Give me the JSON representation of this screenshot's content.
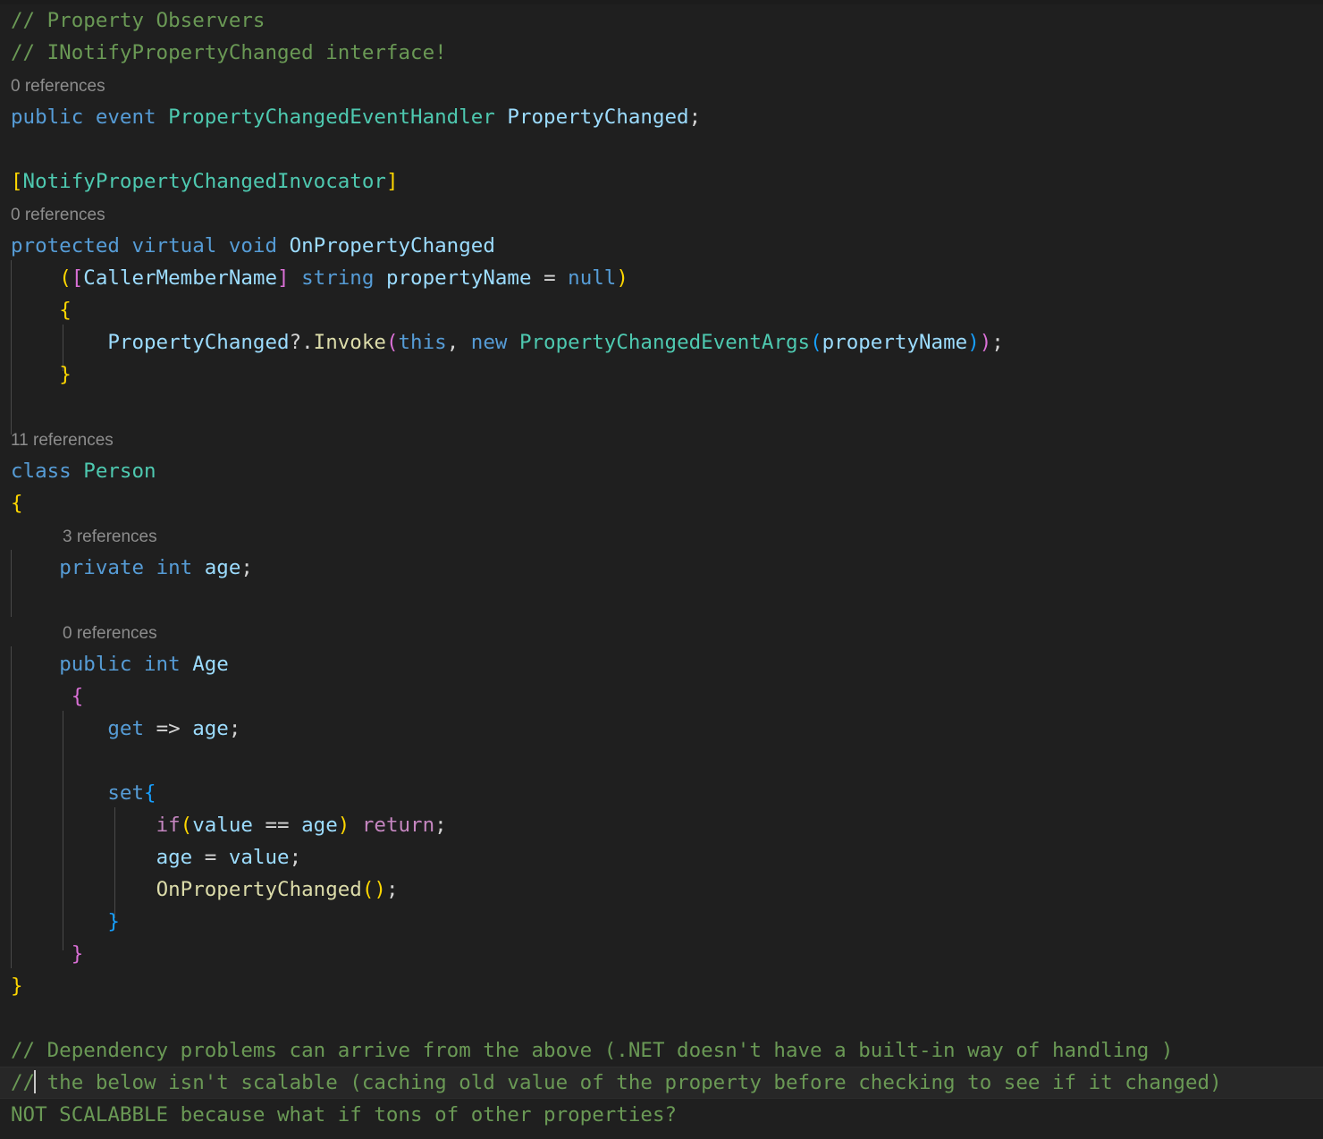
{
  "editor": {
    "language": "csharp",
    "theme": "Dark+",
    "background_color": "#1f1f1f",
    "current_line_background": "#272727",
    "indent_guide_color": "#494949",
    "cursor_color": "#c8c8c8",
    "colors": {
      "comment": "#6a9955",
      "keyword": "#569cd6",
      "control_keyword": "#c586c0",
      "type": "#4ec9b0",
      "identifier": "#9cdcfe",
      "function": "#dcdcaa",
      "plain": "#d4d4d4",
      "codelens": "#8d8d8d",
      "bracket_level_0": "#ffd700",
      "bracket_level_1": "#da70d6",
      "bracket_level_2": "#179fff"
    }
  },
  "codelens": {
    "event_refs": "0 references",
    "onpropertychanged_refs": "0 references",
    "class_person_refs": "11 references",
    "age_field_refs": "3 references",
    "age_property_refs": "0 references"
  },
  "code": {
    "comment_property_observers": "// Property Observers",
    "comment_inotifypropertychanged": "// INotifyPropertyChanged interface!",
    "line_public_event": {
      "public": "public",
      "event": "event",
      "handler_type": "PropertyChangedEventHandler",
      "member": "PropertyChanged",
      "semicolon": ";"
    },
    "attribute_invocator": {
      "open": "[",
      "name": "NotifyPropertyChangedInvocator",
      "close": "]"
    },
    "method_signature": {
      "protected": "protected",
      "virtual": "virtual",
      "void": "void",
      "name": "OnPropertyChanged"
    },
    "method_params": {
      "open_paren": "(",
      "attr_open": "[",
      "attr_name": "CallerMemberName",
      "attr_close": "]",
      "string": "string",
      "param": "propertyName",
      "equals": "=",
      "null": "null",
      "close_paren": ")"
    },
    "method_open_brace": "{",
    "invoke_line": {
      "member": "PropertyChanged",
      "null_conditional": "?.",
      "invoke": "Invoke",
      "open_paren": "(",
      "this": "this",
      "comma": ",",
      "new": "new",
      "args_type": "PropertyChangedEventArgs",
      "args_open_paren": "(",
      "arg": "propertyName",
      "args_close_paren": ")",
      "close_paren": ")",
      "semicolon": ";"
    },
    "method_close_brace": "}",
    "class_decl": {
      "class": "class",
      "name": "Person"
    },
    "class_open_brace": "{",
    "field_age": {
      "private": "private",
      "int": "int",
      "name": "age",
      "semicolon": ";"
    },
    "property_age": {
      "public": "public",
      "int": "int",
      "name": "Age"
    },
    "property_open_brace": "{",
    "getter": {
      "get": "get",
      "arrow": "=>",
      "field": "age",
      "semicolon": ";"
    },
    "setter_open": {
      "set": "set",
      "brace": "{"
    },
    "setter_guard": {
      "if": "if",
      "open_paren": "(",
      "value": "value",
      "operator": "==",
      "field": "age",
      "close_paren": ")",
      "return": "return",
      "semicolon": ";"
    },
    "setter_assign": {
      "field": "age",
      "equals": "=",
      "value": "value",
      "semicolon": ";"
    },
    "setter_notify": {
      "call": "OnPropertyChanged",
      "open_paren": "(",
      "close_paren": ")",
      "semicolon": ";"
    },
    "setter_close_brace": "}",
    "property_close_brace": "}",
    "class_close_brace": "}",
    "comment_dependency": "// Dependency problems can arrive from the above (.NET doesn't have a built-in way of handling )",
    "comment_scalable_prefix": "//",
    "comment_scalable_rest": " the below isn't scalable (caching old value of the property before checking to see if it changed)",
    "comment_not_scalabble": "NOT SCALABBLE because what if tons of other properties?"
  }
}
